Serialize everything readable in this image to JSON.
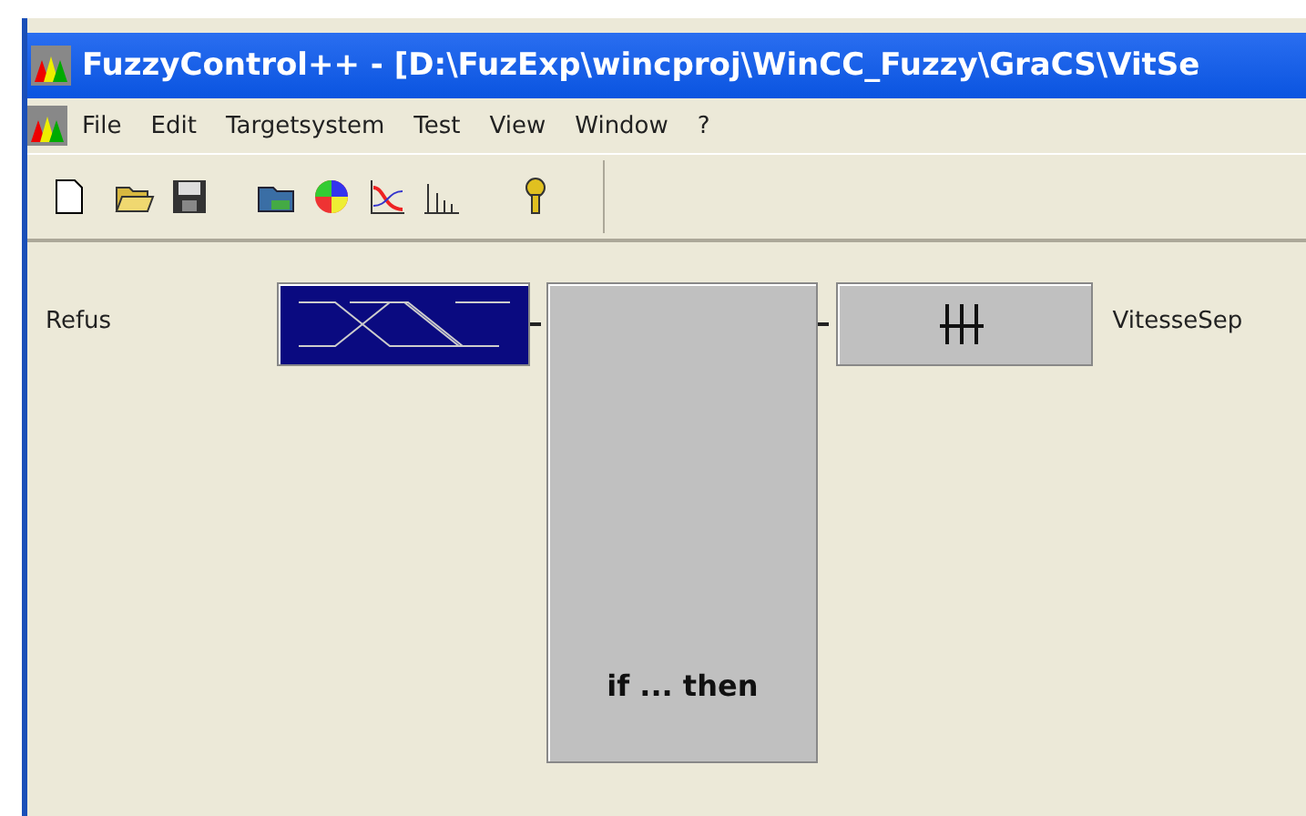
{
  "window": {
    "title": "FuzzyControl++ - [D:\\FuzExp\\wincproj\\WinCC_Fuzzy\\GraCS\\VitSe"
  },
  "menu": [
    {
      "label": "File"
    },
    {
      "label": "Edit"
    },
    {
      "label": "Targetsystem"
    },
    {
      "label": "Test"
    },
    {
      "label": "View"
    },
    {
      "label": "Window"
    },
    {
      "label": "?"
    }
  ],
  "diagram": {
    "input": {
      "label": "Refus",
      "selected": true
    },
    "rules": {
      "label": "if ... then",
      "selected": false
    },
    "output": {
      "label": "VitesseSep",
      "selected": false
    }
  }
}
